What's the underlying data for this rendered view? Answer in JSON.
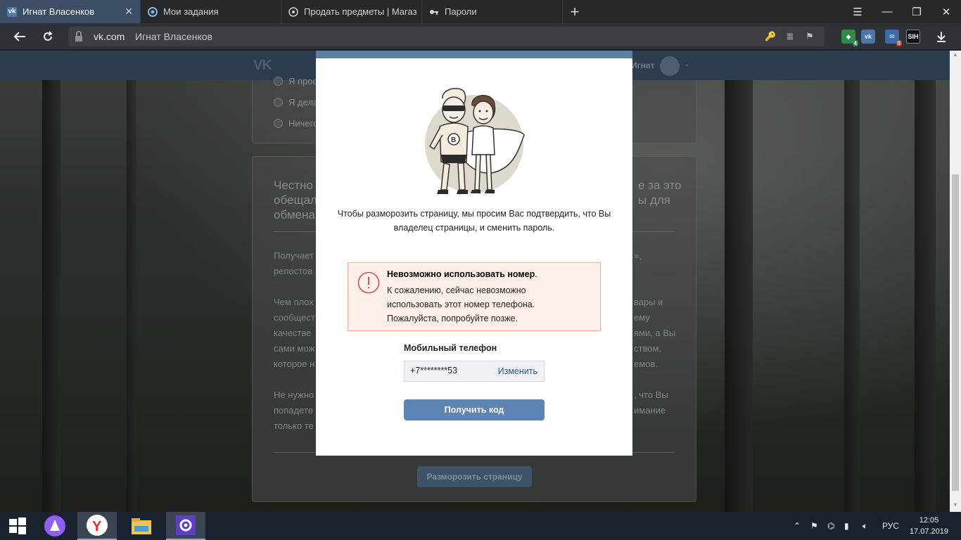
{
  "browser": {
    "tabs": [
      {
        "label": "Игнат Власенков",
        "active": true,
        "icon": "vk-icon"
      },
      {
        "label": "Мои задания",
        "active": false,
        "icon": "task-icon"
      },
      {
        "label": "Продать предметы | Магаз",
        "active": false,
        "icon": "steam-icon"
      },
      {
        "label": "Пароли",
        "active": false,
        "icon": "key-icon"
      }
    ],
    "address": {
      "domain": "vk.com",
      "page_title": "Игнат Власенков"
    },
    "extensions": [
      {
        "name": "shield-ext-icon",
        "badge": "4",
        "color": "#2e8b4a"
      },
      {
        "name": "vk-ext-icon",
        "label": "vk",
        "color": "#4a76a8"
      },
      {
        "name": "mail-ext-icon",
        "badge": "0",
        "color": "#c0392b"
      },
      {
        "name": "sih-ext-icon",
        "label": "SIH",
        "color": "#111111"
      }
    ]
  },
  "vk": {
    "header": {
      "user_name": "Игнат"
    },
    "background": {
      "options": [
        "Я просто...",
        "Я делаю...",
        "Ничего..."
      ],
      "heading": [
        "Честно",
        "обещал",
        "обмена"
      ],
      "heading_right": [
        "е за это",
        "ы для"
      ],
      "para_left": [
        "Получает",
        "репостов",
        "Чем плох",
        "сообщест",
        "качестве",
        "сами мож",
        "которое н",
        "Не нужно",
        "попадете",
        "только те"
      ],
      "para_right": [
        "»,",
        "вары и",
        "ему",
        "ями, а Вы",
        "ством,",
        "емов.",
        ", что Вы",
        "имание"
      ],
      "button": "Разморозить страницу"
    },
    "modal": {
      "description": "Чтобы разморозить страницу, мы просим Вас подтвердить, что Вы владелец страницы, и сменить пароль.",
      "error": {
        "title": "Невозможно использовать номер",
        "title_suffix": ".",
        "line1": "К сожалению, сейчас невозможно",
        "line2": "использовать этот номер телефона.",
        "line3": "Пожалуйста, попробуйте позже."
      },
      "phone_label": "Мобильный телефон",
      "phone_value": "+7********53",
      "change_label": "Изменить",
      "button_label": "Получить код"
    }
  },
  "taskbar": {
    "language": "РУС",
    "time": "12:05",
    "date": "17.07.2019"
  }
}
